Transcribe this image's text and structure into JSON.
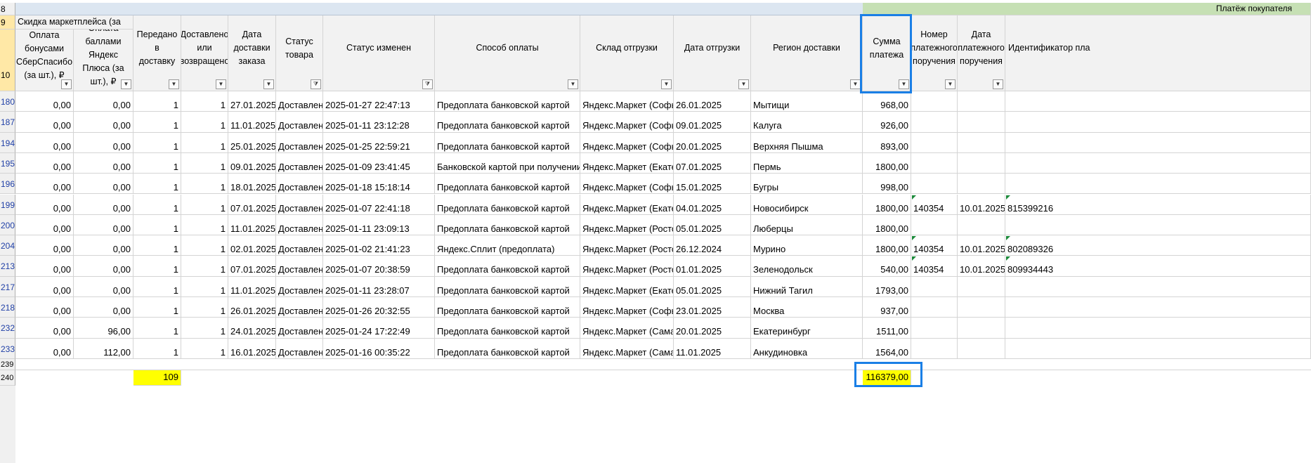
{
  "row_numbers": {
    "r8": "8",
    "r9": "9",
    "r10": "10",
    "r239": "239",
    "r240": "240"
  },
  "group_headers": {
    "discount": "Скидка маркетплейса (за",
    "payment": "Платёж покупателя"
  },
  "columns": [
    {
      "key": "sber",
      "label": "Оплата бонусами СберСпасибо (за шт.), ₽"
    },
    {
      "key": "yandex_plus",
      "label": "Оплата баллами Яндекс Плюса (за шт.), ₽"
    },
    {
      "key": "shipped",
      "label": "Передано в доставку"
    },
    {
      "key": "delivered",
      "label": "Доставлено или возвращено"
    },
    {
      "key": "order_date",
      "label": "Дата доставки заказа"
    },
    {
      "key": "status",
      "label": "Статус товара"
    },
    {
      "key": "status_changed",
      "label": "Статус изменен"
    },
    {
      "key": "pay_method",
      "label": "Способ оплаты"
    },
    {
      "key": "warehouse",
      "label": "Склад отгрузки"
    },
    {
      "key": "ship_date",
      "label": "Дата отгрузки"
    },
    {
      "key": "region",
      "label": "Регион доставки"
    },
    {
      "key": "amount",
      "label": "Сумма платежа"
    },
    {
      "key": "order_no",
      "label": "Номер платежного поручения"
    },
    {
      "key": "order_pay_date",
      "label": "Дата платежного поручения"
    },
    {
      "key": "ident",
      "label": "Идентификатор пла"
    }
  ],
  "rows": [
    {
      "n": "180",
      "sber": "0,00",
      "yandex_plus": "0,00",
      "shipped": "1",
      "delivered": "1",
      "order_date": "27.01.2025",
      "status": "Доставлен (",
      "status_changed": "2025-01-27 22:47:13",
      "pay_method": "Предоплата банковской картой",
      "warehouse": "Яндекс.Маркет (Софьи",
      "ship_date": "26.01.2025",
      "region": "Мытищи",
      "amount": "968,00",
      "order_no": "",
      "order_pay_date": "",
      "ident": ""
    },
    {
      "n": "187",
      "sber": "0,00",
      "yandex_plus": "0,00",
      "shipped": "1",
      "delivered": "1",
      "order_date": "11.01.2025",
      "status": "Доставлен (",
      "status_changed": "2025-01-11 23:12:28",
      "pay_method": "Предоплата банковской картой",
      "warehouse": "Яндекс.Маркет (Софьи",
      "ship_date": "09.01.2025",
      "region": "Калуга",
      "amount": "926,00",
      "order_no": "",
      "order_pay_date": "",
      "ident": ""
    },
    {
      "n": "194",
      "sber": "0,00",
      "yandex_plus": "0,00",
      "shipped": "1",
      "delivered": "1",
      "order_date": "25.01.2025",
      "status": "Доставлен (",
      "status_changed": "2025-01-25 22:59:21",
      "pay_method": "Предоплата банковской картой",
      "warehouse": "Яндекс.Маркет (Софьи",
      "ship_date": "20.01.2025",
      "region": "Верхняя Пышма",
      "amount": "893,00",
      "order_no": "",
      "order_pay_date": "",
      "ident": ""
    },
    {
      "n": "195",
      "sber": "0,00",
      "yandex_plus": "0,00",
      "shipped": "1",
      "delivered": "1",
      "order_date": "09.01.2025",
      "status": "Доставлен (",
      "status_changed": "2025-01-09 23:41:45",
      "pay_method": "Банковской картой при получении",
      "warehouse": "Яндекс.Маркет (Екатер",
      "ship_date": "07.01.2025",
      "region": "Пермь",
      "amount": "1800,00",
      "order_no": "",
      "order_pay_date": "",
      "ident": ""
    },
    {
      "n": "196",
      "sber": "0,00",
      "yandex_plus": "0,00",
      "shipped": "1",
      "delivered": "1",
      "order_date": "18.01.2025",
      "status": "Доставлен (",
      "status_changed": "2025-01-18 15:18:14",
      "pay_method": "Предоплата банковской картой",
      "warehouse": "Яндекс.Маркет (Софьи",
      "ship_date": "15.01.2025",
      "region": "Бугры",
      "amount": "998,00",
      "order_no": "",
      "order_pay_date": "",
      "ident": ""
    },
    {
      "n": "199",
      "sber": "0,00",
      "yandex_plus": "0,00",
      "shipped": "1",
      "delivered": "1",
      "order_date": "07.01.2025",
      "status": "Доставлен (",
      "status_changed": "2025-01-07 22:41:18",
      "pay_method": "Предоплата банковской картой",
      "warehouse": "Яндекс.Маркет (Екатер",
      "ship_date": "04.01.2025",
      "region": "Новосибирск",
      "amount": "1800,00",
      "order_no": "140354",
      "order_pay_date": "10.01.2025",
      "ident": "815399216"
    },
    {
      "n": "200",
      "sber": "0,00",
      "yandex_plus": "0,00",
      "shipped": "1",
      "delivered": "1",
      "order_date": "11.01.2025",
      "status": "Доставлен (",
      "status_changed": "2025-01-11 23:09:13",
      "pay_method": "Предоплата банковской картой",
      "warehouse": "Яндекс.Маркет (Ростов",
      "ship_date": "05.01.2025",
      "region": "Люберцы",
      "amount": "1800,00",
      "order_no": "",
      "order_pay_date": "",
      "ident": ""
    },
    {
      "n": "204",
      "sber": "0,00",
      "yandex_plus": "0,00",
      "shipped": "1",
      "delivered": "1",
      "order_date": "02.01.2025",
      "status": "Доставлен (",
      "status_changed": "2025-01-02 21:41:23",
      "pay_method": "Яндекс.Сплит (предоплата)",
      "warehouse": "Яндекс.Маркет (Ростов",
      "ship_date": "26.12.2024",
      "region": "Мурино",
      "amount": "1800,00",
      "order_no": "140354",
      "order_pay_date": "10.01.2025",
      "ident": "802089326"
    },
    {
      "n": "213",
      "sber": "0,00",
      "yandex_plus": "0,00",
      "shipped": "1",
      "delivered": "1",
      "order_date": "07.01.2025",
      "status": "Доставлен (",
      "status_changed": "2025-01-07 20:38:59",
      "pay_method": "Предоплата банковской картой",
      "warehouse": "Яндекс.Маркет (Ростов",
      "ship_date": "01.01.2025",
      "region": "Зеленодольск",
      "amount": "540,00",
      "order_no": "140354",
      "order_pay_date": "10.01.2025",
      "ident": "809934443"
    },
    {
      "n": "217",
      "sber": "0,00",
      "yandex_plus": "0,00",
      "shipped": "1",
      "delivered": "1",
      "order_date": "11.01.2025",
      "status": "Доставлен (",
      "status_changed": "2025-01-11 23:28:07",
      "pay_method": "Предоплата банковской картой",
      "warehouse": "Яндекс.Маркет (Екатер",
      "ship_date": "05.01.2025",
      "region": "Нижний Тагил",
      "amount": "1793,00",
      "order_no": "",
      "order_pay_date": "",
      "ident": ""
    },
    {
      "n": "218",
      "sber": "0,00",
      "yandex_plus": "0,00",
      "shipped": "1",
      "delivered": "1",
      "order_date": "26.01.2025",
      "status": "Доставлен (",
      "status_changed": "2025-01-26 20:32:55",
      "pay_method": "Предоплата банковской картой",
      "warehouse": "Яндекс.Маркет (Софьи",
      "ship_date": "23.01.2025",
      "region": "Москва",
      "amount": "937,00",
      "order_no": "",
      "order_pay_date": "",
      "ident": ""
    },
    {
      "n": "232",
      "sber": "0,00",
      "yandex_plus": "96,00",
      "shipped": "1",
      "delivered": "1",
      "order_date": "24.01.2025",
      "status": "Доставлен (",
      "status_changed": "2025-01-24 17:22:49",
      "pay_method": "Предоплата банковской картой",
      "warehouse": "Яндекс.Маркет (Самар",
      "ship_date": "20.01.2025",
      "region": "Екатеринбург",
      "amount": "1511,00",
      "order_no": "",
      "order_pay_date": "",
      "ident": ""
    },
    {
      "n": "233",
      "sber": "0,00",
      "yandex_plus": "112,00",
      "shipped": "1",
      "delivered": "1",
      "order_date": "16.01.2025",
      "status": "Доставлен (",
      "status_changed": "2025-01-16 00:35:22",
      "pay_method": "Предоплата банковской картой",
      "warehouse": "Яндекс.Маркет (Самар",
      "ship_date": "11.01.2025",
      "region": "Анкудиновка",
      "amount": "1564,00",
      "order_no": "",
      "order_pay_date": "",
      "ident": ""
    }
  ],
  "totals": {
    "shipped": "109",
    "amount": "116379,00"
  },
  "filter_icons": {
    "default": "▼",
    "active": "filter-funnel"
  },
  "colors": {
    "green_header": "#c6e0b4",
    "highlight_total": "#ffff00",
    "selection_border": "#1a7fe6",
    "row_number_color": "#1f3fa6"
  }
}
